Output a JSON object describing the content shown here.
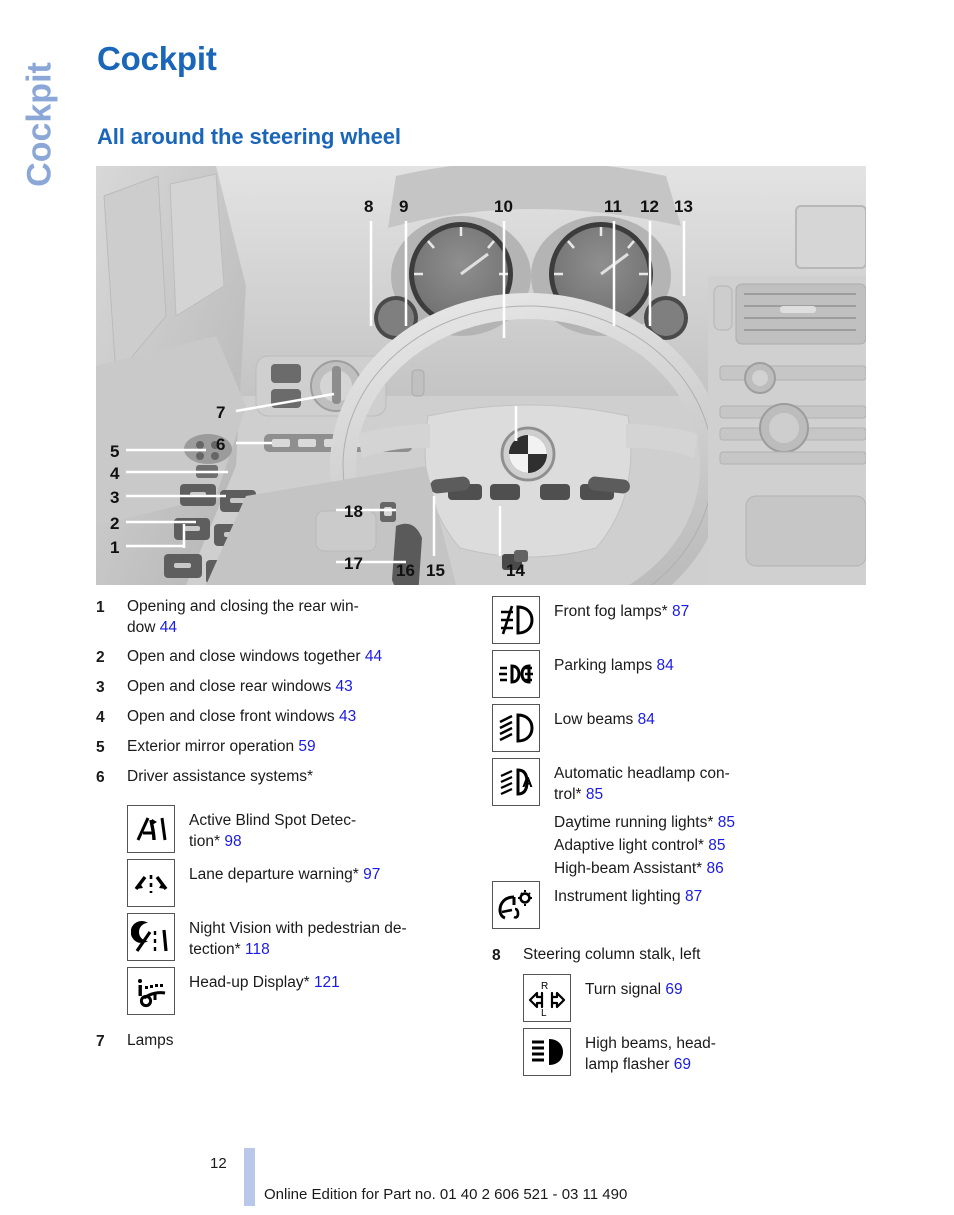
{
  "chapter_tab": "Cockpit",
  "title": "Cockpit",
  "subtitle": "All around the steering wheel",
  "photo": {
    "alt": "Cockpit overview with steering wheel, instrument cluster, door controls and center console",
    "callouts": [
      "1",
      "2",
      "3",
      "4",
      "5",
      "6",
      "7",
      "8",
      "9",
      "10",
      "11",
      "12",
      "13",
      "14",
      "15",
      "16",
      "17",
      "18"
    ]
  },
  "left_column": [
    {
      "num": "1",
      "text": "Opening and closing the rear win-",
      "text2": "dow",
      "page": "44"
    },
    {
      "num": "2",
      "text": "Open and close windows together",
      "page": "44"
    },
    {
      "num": "3",
      "text": "Open and close rear windows",
      "page": "43"
    },
    {
      "num": "4",
      "text": "Open and close front windows",
      "page": "43"
    },
    {
      "num": "5",
      "text": "Exterior mirror operation",
      "page": "59"
    },
    {
      "num": "6",
      "text": "Driver assistance systems*",
      "page": ""
    }
  ],
  "driver_assistance": [
    {
      "icon": "blind-spot-detection-icon",
      "text": "Active Blind Spot Detec-",
      "text2": "tion*",
      "page": "98"
    },
    {
      "icon": "lane-departure-warning-icon",
      "text": "Lane departure warning*",
      "page": "97"
    },
    {
      "icon": "night-vision-icon",
      "text": "Night Vision with pedestrian de-",
      "text2": "tection*",
      "page": "118"
    },
    {
      "icon": "head-up-display-icon",
      "text": "Head-up Display*",
      "page": "121"
    }
  ],
  "item7": {
    "num": "7",
    "text": "Lamps"
  },
  "lamps": [
    {
      "icon": "front-fog-lamps-icon",
      "text": "Front fog lamps*",
      "page": "87"
    },
    {
      "icon": "parking-lamps-icon",
      "text": "Parking lamps",
      "page": "84"
    },
    {
      "icon": "low-beams-icon",
      "text": "Low beams",
      "page": "84"
    },
    {
      "icon": "automatic-headlamp-control-icon",
      "text": "Automatic headlamp con-",
      "text2": "trol*",
      "page": "85"
    }
  ],
  "lamps_sub": [
    {
      "text": "Daytime running lights*",
      "page": "85"
    },
    {
      "text": "Adaptive light control*",
      "page": "85"
    },
    {
      "text": "High-beam Assistant*",
      "page": "86"
    }
  ],
  "instrument_lighting": {
    "icon": "instrument-lighting-icon",
    "text": "Instrument lighting",
    "page": "87"
  },
  "item8": {
    "num": "8",
    "text": "Steering column stalk, left"
  },
  "stalk_items": [
    {
      "icon": "turn-signal-icon",
      "text": "Turn signal",
      "page": "69"
    },
    {
      "icon": "high-beams-flasher-icon",
      "text": "High beams, head-",
      "text2": "lamp flasher",
      "page": "69"
    }
  ],
  "footer": {
    "page_number": "12",
    "edition_line": "Online Edition for Part no. 01 40 2 606 521 - 03 11 490"
  },
  "colors": {
    "heading_blue": "#1a66b8",
    "tab_blue": "#8aa7d8",
    "page_ref_blue": "#1a1ae6",
    "footer_bar": "#b9c7e8"
  }
}
